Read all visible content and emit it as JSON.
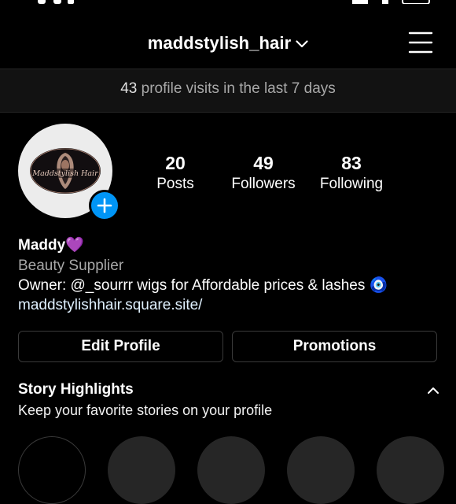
{
  "header": {
    "username": "maddstylish_hair",
    "dropdown_icon": "chevron-down-icon",
    "menu_icon": "hamburger-menu-icon"
  },
  "visits": {
    "count": "43",
    "text": " profile visits in the last 7 days"
  },
  "stats": [
    {
      "value": "20",
      "label": "Posts"
    },
    {
      "value": "49",
      "label": "Followers"
    },
    {
      "value": "83",
      "label": "Following"
    }
  ],
  "bio": {
    "name": "Maddy💜",
    "category": "Beauty Supplier",
    "line": "Owner: @_sourrr wigs for Affordable prices & lashes 🧿",
    "link": "maddstylishhair.square.site/"
  },
  "avatar": {
    "logo_text": "Maddstylish Hair"
  },
  "buttons": {
    "edit": "Edit Profile",
    "promotions": "Promotions"
  },
  "highlights": {
    "title": "Story Highlights",
    "subtitle": "Keep your favorite stories on your profile"
  },
  "colors": {
    "accent": "#0095f6",
    "background": "#000000",
    "secondary_text": "#a8a8a8"
  }
}
